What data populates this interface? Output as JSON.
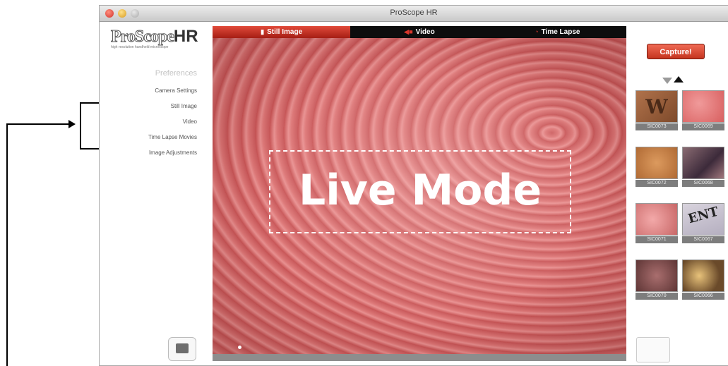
{
  "window": {
    "title": "ProScope HR"
  },
  "logo": {
    "main": "ProScope",
    "accent": "HR",
    "tagline": "high resolution handheld microscope"
  },
  "preferences": {
    "title": "Preferences",
    "items": [
      {
        "label": "Camera Settings"
      },
      {
        "label": "Still Image"
      },
      {
        "label": "Video"
      },
      {
        "label": "Time Lapse Movies"
      },
      {
        "label": "Image Adjustments"
      }
    ]
  },
  "tabs": [
    {
      "label": "Still Image",
      "icon": "document-icon",
      "active": true
    },
    {
      "label": "Video",
      "icon": "video-camera-icon",
      "active": false
    },
    {
      "label": "Time Lapse",
      "icon": "clock-icon",
      "active": false
    }
  ],
  "live": {
    "label": "Live Mode"
  },
  "capture": {
    "label": "Capture!"
  },
  "thumbnails": [
    {
      "caption": "SIC0073",
      "overlay": "W"
    },
    {
      "caption": "SIC0069",
      "overlay": ""
    },
    {
      "caption": "SIC0072",
      "overlay": ""
    },
    {
      "caption": "SIC0068",
      "overlay": ""
    },
    {
      "caption": "SIC0071",
      "overlay": ""
    },
    {
      "caption": "SIC0067",
      "overlay": "ENT"
    },
    {
      "caption": "SIC0070",
      "overlay": ""
    },
    {
      "caption": "SIC0066",
      "overlay": ""
    }
  ],
  "colors": {
    "accent": "#c5351f",
    "tab_bar": "#0d0d0d",
    "live_base": "#d46a6a"
  }
}
